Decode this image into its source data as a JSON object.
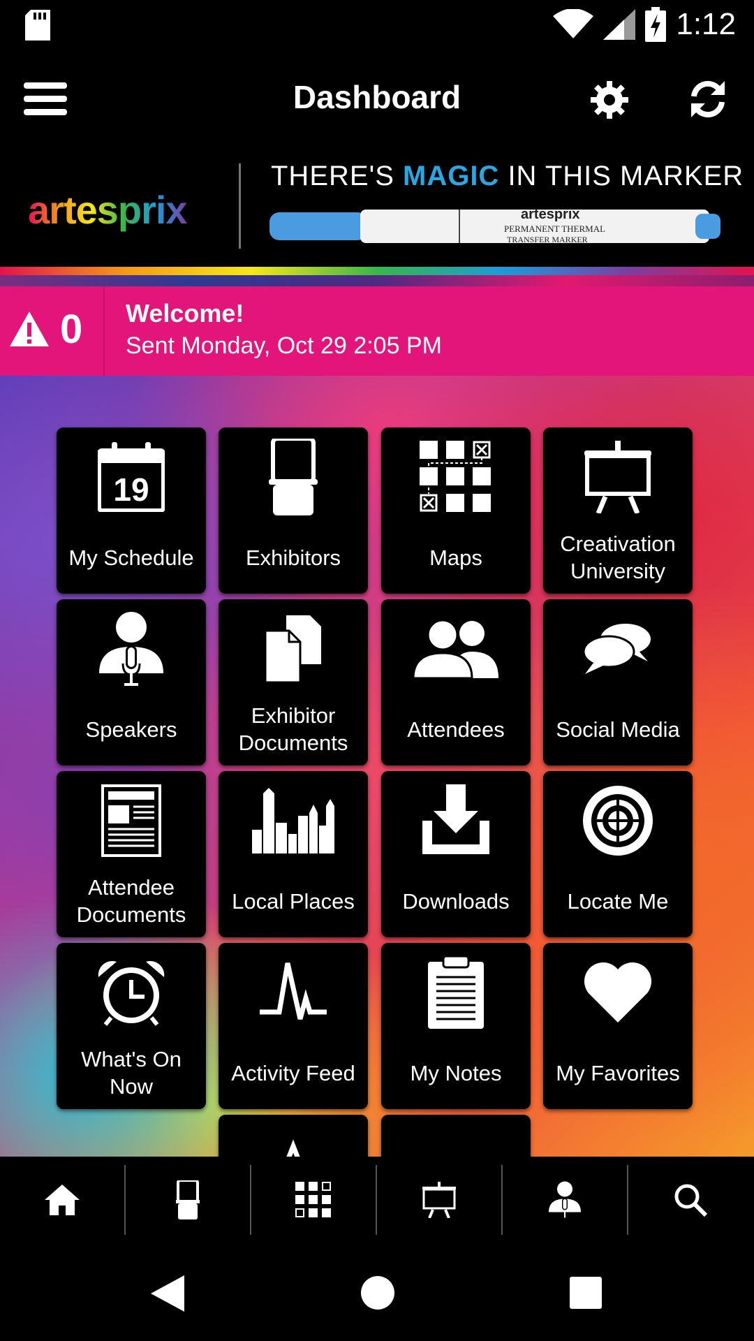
{
  "status_bar": {
    "time": "1:12",
    "icons": [
      "sd-card-icon",
      "wifi-icon",
      "signal-icon",
      "battery-charging-icon"
    ]
  },
  "app_bar": {
    "title": "Dashboard",
    "icons": [
      "menu-icon",
      "gear-icon",
      "refresh-icon"
    ]
  },
  "banner": {
    "logo_text": "artesprix",
    "tagline_pre": "THERE'S ",
    "tagline_magic": "MAGIC",
    "tagline_post": " IN THIS MARKER",
    "marker_brand": "artesprix",
    "marker_line1": "PERMANENT THERMAL",
    "marker_line2": "TRANSFER MARKER",
    "magic_color": "#2aa7e0"
  },
  "alert": {
    "count": "0",
    "title": "Welcome!",
    "subtitle": "Sent Monday, Oct 29 2:05 PM",
    "color": "#e3157a"
  },
  "tiles": [
    {
      "label": "My Schedule",
      "icon": "calendar-icon",
      "calendar_day": "19"
    },
    {
      "label": "Exhibitors",
      "icon": "booth-icon"
    },
    {
      "label": "Maps",
      "icon": "map-grid-icon"
    },
    {
      "label": "Creativation University",
      "icon": "easel-icon"
    },
    {
      "label": "Speakers",
      "icon": "speaker-mic-icon"
    },
    {
      "label": "Exhibitor Documents",
      "icon": "documents-icon"
    },
    {
      "label": "Attendees",
      "icon": "people-icon"
    },
    {
      "label": "Social Media",
      "icon": "chat-bubbles-icon"
    },
    {
      "label": "Attendee Documents",
      "icon": "newspaper-icon"
    },
    {
      "label": "Local Places",
      "icon": "city-skyline-icon"
    },
    {
      "label": "Downloads",
      "icon": "download-icon"
    },
    {
      "label": "Locate Me",
      "icon": "target-icon"
    },
    {
      "label": "What's On Now",
      "icon": "alarm-clock-icon"
    },
    {
      "label": "Activity Feed",
      "icon": "pulse-icon"
    },
    {
      "label": "My Notes",
      "icon": "clipboard-icon"
    },
    {
      "label": "My Favorites",
      "icon": "heart-icon"
    }
  ],
  "bottom_nav": [
    "home-icon",
    "booth-icon",
    "map-grid-icon",
    "easel-icon",
    "speaker-mic-icon",
    "search-icon"
  ],
  "system_nav": [
    "back-icon",
    "home-circle-icon",
    "recents-icon"
  ]
}
